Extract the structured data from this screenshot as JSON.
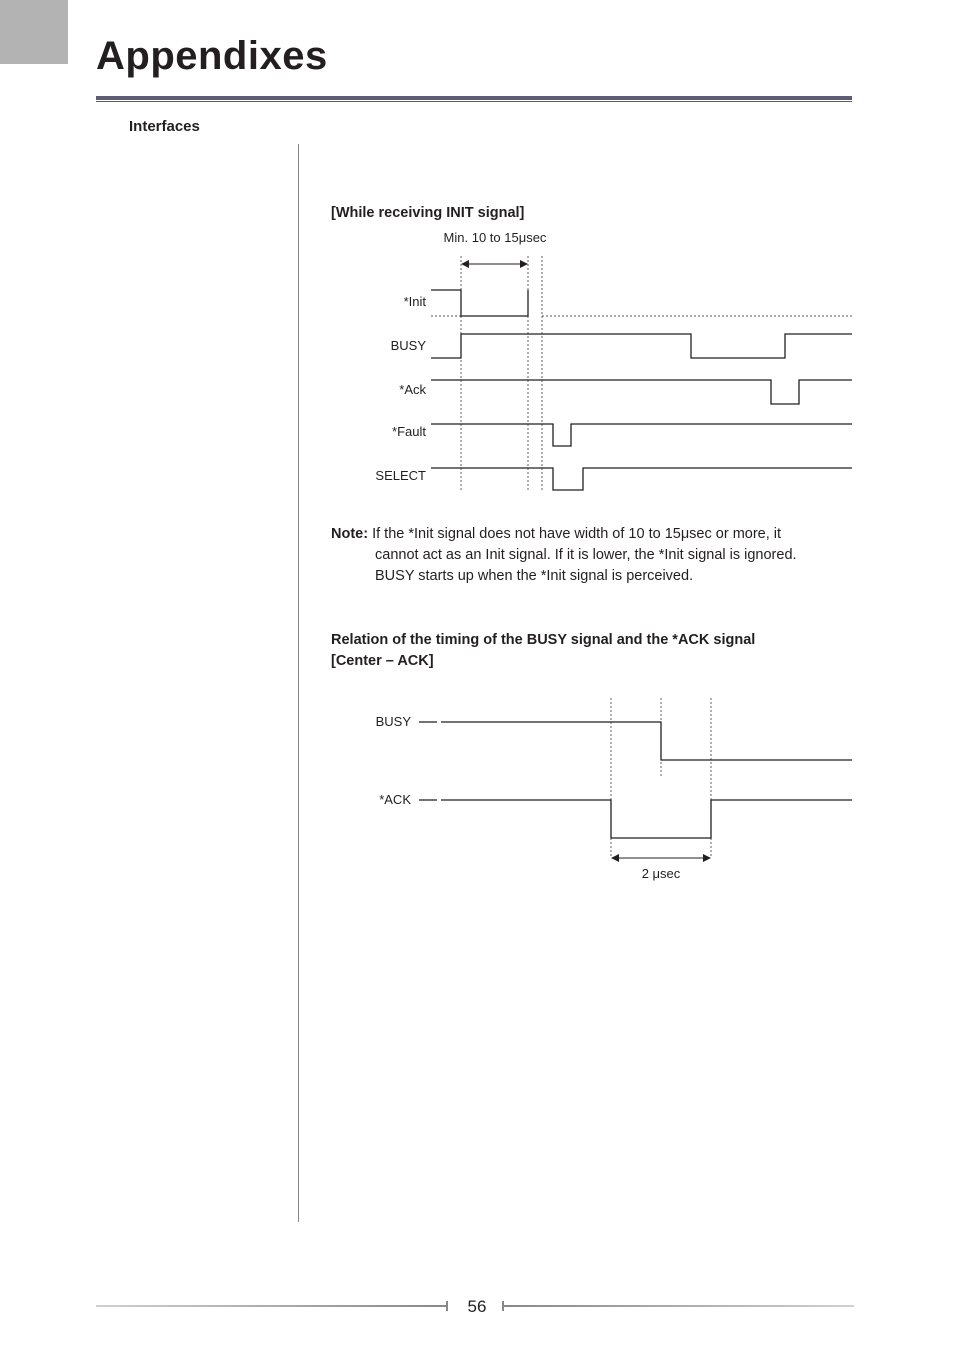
{
  "page": {
    "title": "Appendixes",
    "section": "Interfaces",
    "number": "56"
  },
  "diagram1": {
    "title": "[While receiving INIT signal]",
    "timing_label": "Min. 10 to 15μsec",
    "signals": [
      "*Init",
      "BUSY",
      "*Ack",
      "*Fault",
      "SELECT"
    ]
  },
  "note": {
    "tag": "Note:",
    "line1": "If the *Init signal does not have width of 10 to 15μsec or more, it",
    "line2": "cannot act as an Init signal. If it is lower, the *Init signal is ignored.",
    "line3": "BUSY starts up when the *Init signal is perceived."
  },
  "diagram2": {
    "title_line1": "Relation of the timing of the BUSY signal and the *ACK signal",
    "title_line2": "[Center – ACK]",
    "signals": [
      "BUSY",
      "*ACK"
    ],
    "timing_label": "2 μsec"
  },
  "chart_data": [
    {
      "type": "timing-diagram",
      "title": "[While receiving INIT signal]",
      "annotation": "Min. 10 to 15μsec (width of *Init low pulse)",
      "signals": [
        {
          "name": "*Init",
          "levels": "high → low (pulse 10–15μsec) → high (dotted, undefined after)"
        },
        {
          "name": "BUSY",
          "levels": "low → high at *Init falling edge → low later → high near end"
        },
        {
          "name": "*Ack",
          "levels": "high → brief low pulse after BUSY falls → high"
        },
        {
          "name": "*Fault",
          "levels": "high → brief low pulse shortly after *Init recovers → high"
        },
        {
          "name": "SELECT",
          "levels": "high → low shortly after *Init recovers → high"
        }
      ]
    },
    {
      "type": "timing-diagram",
      "title": "Relation of the timing of the BUSY signal and the *ACK signal [Center – ACK]",
      "annotation": "2 μsec (width of *ACK low pulse)",
      "signals": [
        {
          "name": "BUSY",
          "levels": "high → falls to low at center of *ACK low pulse"
        },
        {
          "name": "*ACK",
          "levels": "high → low pulse (2 μsec) → high; BUSY edge centered in pulse"
        }
      ]
    }
  ]
}
